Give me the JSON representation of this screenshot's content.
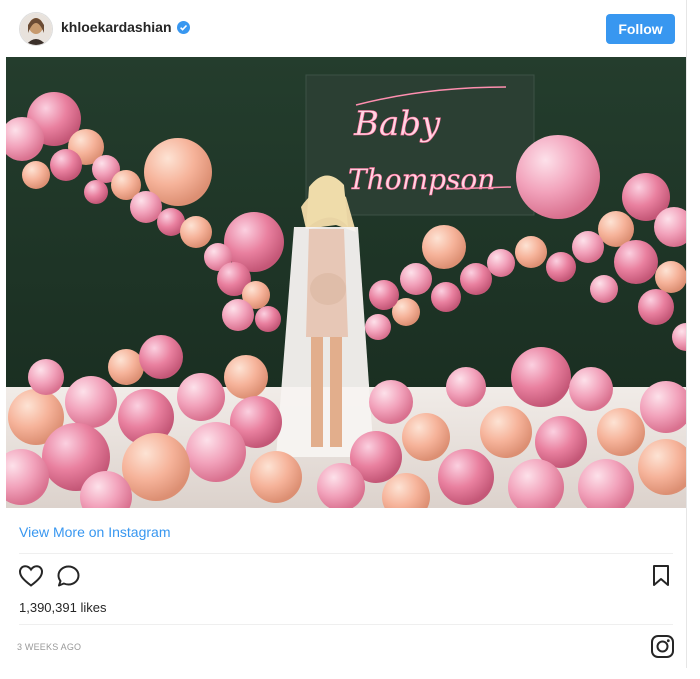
{
  "post": {
    "username": "khloekardashian",
    "follow_label": "Follow",
    "photo": {
      "neon_sign_line1": "Baby",
      "neon_sign_line2": "Thompson"
    },
    "view_more_label": "View More on Instagram",
    "likes": "1,390,391 likes",
    "time_ago": "3 WEEKS AGO"
  },
  "colors": {
    "follow_button": "#3897f0",
    "link": "#3897f0",
    "verified_badge": "#3897f0",
    "backdrop": "#1f3a29",
    "balloon_pink": "#f2a9c0",
    "balloon_peach": "#f6b39a"
  },
  "icons": {
    "like": "heart-icon",
    "comment": "comment-icon",
    "save": "bookmark-icon",
    "brand": "instagram-icon",
    "verified": "verified-badge-icon"
  }
}
